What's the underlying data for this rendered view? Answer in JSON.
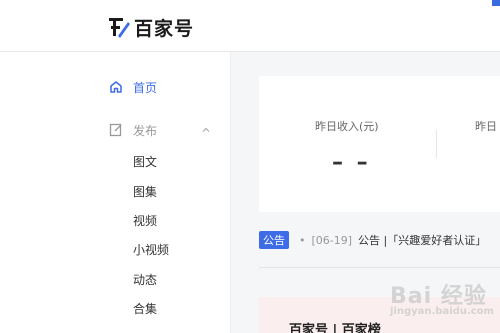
{
  "brand": {
    "name": "百家号",
    "accent_color": "#3e6ce6"
  },
  "sidebar": {
    "home": {
      "label": "首页",
      "icon": "home-icon"
    },
    "publish": {
      "label": "发布",
      "icon": "edit-icon",
      "expanded": true
    },
    "publish_items": [
      "图文",
      "图集",
      "视频",
      "小视频",
      "动态",
      "合集"
    ]
  },
  "stats": {
    "yesterday_income_label": "昨日收入(元)",
    "yesterday_income_value": "– –",
    "second_label": "昨日"
  },
  "notice": {
    "badge": "公告",
    "date": "[06-19]",
    "text": "公告 |「兴趣爱好者认证」"
  },
  "banner": {
    "text": "百家号 | 百家榜"
  },
  "watermark": {
    "text": "Bai 经验",
    "sub": "jingyan.baidu.com"
  }
}
